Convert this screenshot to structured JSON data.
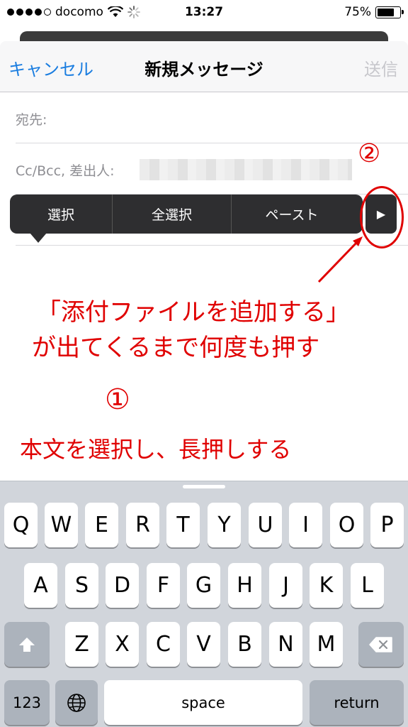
{
  "status_bar": {
    "carrier": "docomo",
    "time": "13:27",
    "battery_percent": "75%",
    "battery_level": 0.75,
    "signal_dots_filled": 4,
    "signal_dots_total": 5
  },
  "nav_bar": {
    "cancel_label": "キャンセル",
    "title": "新規メッセージ",
    "send_label": "送信"
  },
  "fields": {
    "to_label": "宛先:",
    "cc_label": "Cc/Bcc, 差出人:"
  },
  "edit_menu": {
    "items": [
      "選択",
      "全選択",
      "ペースト"
    ],
    "next_icon": "▶"
  },
  "annotations": {
    "num2": "②",
    "line1": "「添付ファイルを追加する」",
    "line2": "が出てくるまで何度も押す",
    "num1": "①",
    "step1": "本文を選択し、長押しする",
    "color": "#e00000"
  },
  "keyboard": {
    "row1": [
      "Q",
      "W",
      "E",
      "R",
      "T",
      "Y",
      "U",
      "I",
      "O",
      "P"
    ],
    "row2": [
      "A",
      "S",
      "D",
      "F",
      "G",
      "H",
      "J",
      "K",
      "L"
    ],
    "row3": [
      "Z",
      "X",
      "C",
      "V",
      "B",
      "N",
      "M"
    ],
    "numbers_label": "123",
    "space_label": "space",
    "return_label": "return"
  },
  "colors": {
    "link_blue": "#1a7de0",
    "disabled_gray": "#c7c7cc",
    "keyboard_bg": "#d1d5db",
    "menu_bg": "#2e2e30"
  }
}
